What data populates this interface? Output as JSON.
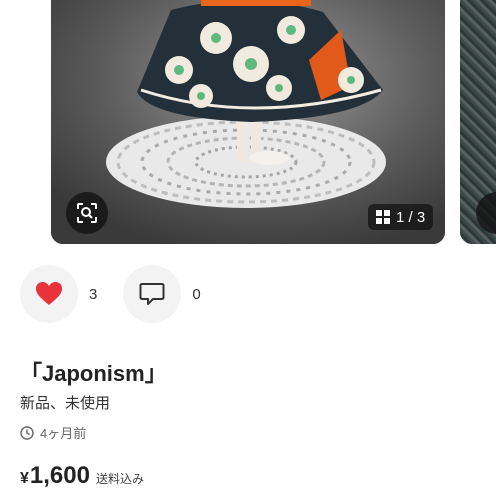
{
  "gallery": {
    "counter": "1 / 3",
    "lens_icon": "image-search-icon",
    "grid_icon": "grid-icon"
  },
  "actions": {
    "like_icon": "heart-icon",
    "like_color": "#e8333a",
    "like_count": "3",
    "comment_icon": "comment-icon",
    "comment_count": "0"
  },
  "item": {
    "title": "「Japonism」",
    "condition": "新品、未使用",
    "posted_icon": "clock-icon",
    "posted_time": "4ヶ月前",
    "currency": "¥",
    "price": "1,600",
    "shipping": "送料込み"
  }
}
